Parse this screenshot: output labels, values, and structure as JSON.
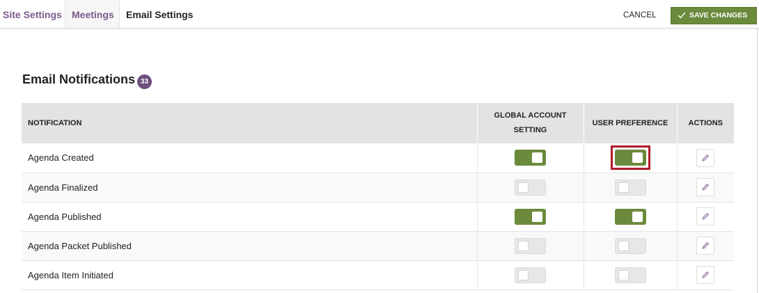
{
  "tabs": [
    {
      "label": "Site Settings"
    },
    {
      "label": "Meetings"
    },
    {
      "label": "Email Settings"
    }
  ],
  "toolbar": {
    "cancel_label": "CANCEL",
    "save_label": "SAVE CHANGES"
  },
  "section": {
    "title": "Email Notifications",
    "count": "33"
  },
  "table": {
    "columns": {
      "notification": "NOTIFICATION",
      "global_line1": "GLOBAL ACCOUNT",
      "global_line2": "SETTING",
      "user_pref": "USER PREFERENCE",
      "actions": "ACTIONS"
    },
    "rows": [
      {
        "name": "Agenda Created",
        "global": true,
        "user": true,
        "user_highlighted": true
      },
      {
        "name": "Agenda Finalized",
        "global": false,
        "user": false
      },
      {
        "name": "Agenda Published",
        "global": true,
        "user": true
      },
      {
        "name": "Agenda Packet Published",
        "global": false,
        "user": false
      },
      {
        "name": "Agenda Item Initiated",
        "global": false,
        "user": false
      }
    ]
  },
  "icons": {
    "edit": "pencil-icon",
    "save": "check-icon"
  },
  "colors": {
    "accent_green": "#6b8a3c",
    "accent_purple": "#7b5a8a",
    "highlight_red": "#b01a2a"
  }
}
